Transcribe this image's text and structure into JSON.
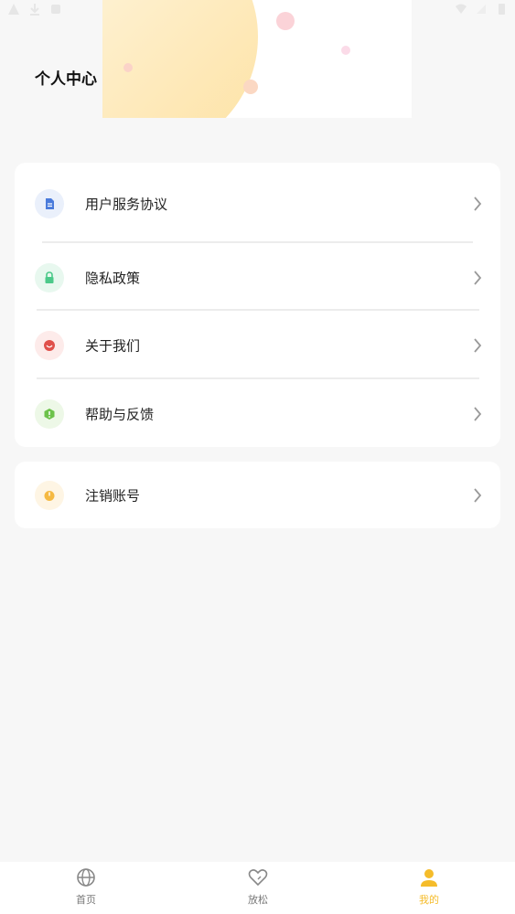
{
  "header": {
    "title": "个人中心"
  },
  "menu": {
    "items": [
      {
        "label": "用户服务协议",
        "icon": "document-icon",
        "color": "#4a7bdb",
        "bg": "#eaf0fb"
      },
      {
        "label": "隐私政策",
        "icon": "lock-icon",
        "color": "#4cc98a",
        "bg": "#e8f8ef"
      },
      {
        "label": "关于我们",
        "icon": "smile-icon",
        "color": "#e0504b",
        "bg": "#fdebea"
      },
      {
        "label": "帮助与反馈",
        "icon": "help-icon",
        "color": "#6cc24a",
        "bg": "#edf8e7"
      }
    ]
  },
  "account": {
    "logout": {
      "label": "注销账号",
      "icon": "power-icon",
      "color": "#f5b942",
      "bg": "#fef5e4"
    }
  },
  "tabbar": {
    "tabs": [
      {
        "label": "首页",
        "icon": "globe-icon",
        "active": false
      },
      {
        "label": "放松",
        "icon": "heart-icon",
        "active": false
      },
      {
        "label": "我的",
        "icon": "person-icon",
        "active": true
      }
    ]
  },
  "colors": {
    "accent": "#f5bc2a",
    "background": "#f7f7f7",
    "card": "#ffffff"
  }
}
